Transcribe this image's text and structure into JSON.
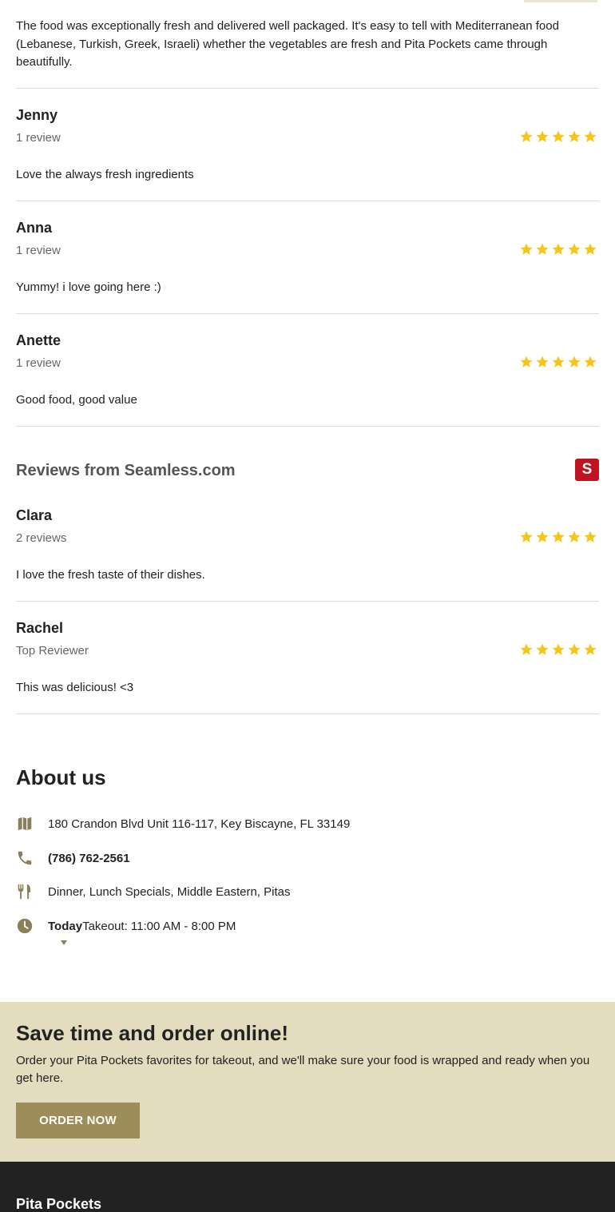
{
  "colors": {
    "star": "#f5c518",
    "icon": "#8a7f58",
    "seamless_brand": "#c1121f",
    "order_band": "#e3dcbf",
    "order_button": "#9c8d5a",
    "footer": "#222222"
  },
  "top_review": {
    "text": "The food was exceptionally fresh and delivered well packaged. It's easy to tell with Mediterranean food (Lebanese, Turkish, Greek, Israeli) whether the vegetables are fresh and Pita Pockets came through beautifully."
  },
  "reviews": [
    {
      "name": "Jenny",
      "meta": "1 review",
      "rating": 5,
      "text": "Love the always fresh ingredients"
    },
    {
      "name": "Anna",
      "meta": "1 review",
      "rating": 5,
      "text": "Yummy! i love going here :)"
    },
    {
      "name": "Anette",
      "meta": "1 review",
      "rating": 5,
      "text": "Good food, good value"
    }
  ],
  "seamless": {
    "title": "Reviews from Seamless.com",
    "logo_letter": "S",
    "reviews": [
      {
        "name": "Clara",
        "meta": "2 reviews",
        "rating": 5,
        "text": "I love the fresh taste of their dishes."
      },
      {
        "name": "Rachel",
        "meta": "Top Reviewer",
        "rating": 5,
        "text": "This was delicious! <3"
      }
    ]
  },
  "about": {
    "title": "About us",
    "address": "180 Crandon Blvd Unit 116-117, Key Biscayne, FL 33149",
    "phone": "(786) 762-2561",
    "cuisine": "Dinner, Lunch Specials, Middle Eastern, Pitas",
    "hours_day": "Today",
    "hours_text": "Takeout: 11:00 AM - 8:00 PM",
    "icons": [
      "map-icon",
      "phone-icon",
      "utensils-icon",
      "clock-icon"
    ]
  },
  "order": {
    "title": "Save time and order online!",
    "description": "Order your Pita Pockets favorites for takeout, and we'll make sure your food is wrapped and ready when you get here.",
    "button_label": "ORDER NOW"
  },
  "footer": {
    "restaurant_name": "Pita Pockets"
  }
}
